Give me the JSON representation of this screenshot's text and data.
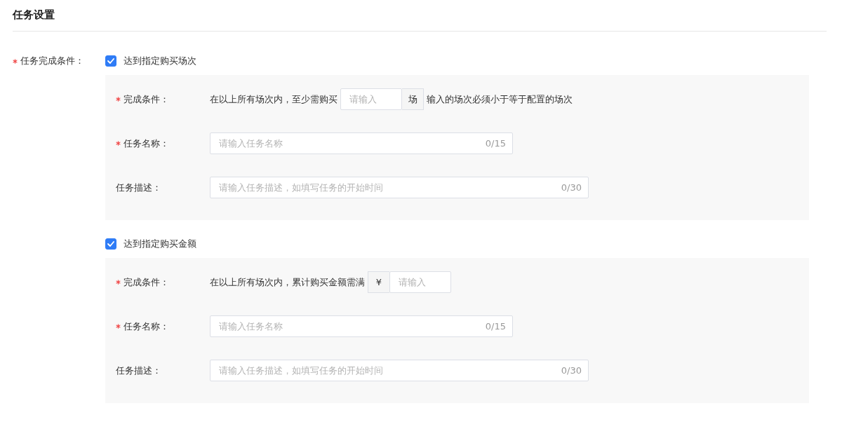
{
  "section_title": "任务设置",
  "field": {
    "label": "任务完成条件：",
    "required": true
  },
  "options": [
    {
      "label": "达到指定购买场次",
      "checked": true,
      "rows": [
        {
          "kind": "condition",
          "label": "完成条件：",
          "required": true,
          "text_before": "在以上所有场次内，至少需购买",
          "input_group": [
            {
              "kind": "input",
              "placeholder": "请输入"
            },
            {
              "kind": "addon",
              "text": "场"
            }
          ],
          "text_after": "输入的场次必须小于等于配置的场次"
        },
        {
          "kind": "name",
          "label": "任务名称：",
          "required": true,
          "placeholder": "请输入任务名称",
          "counter": "0/15"
        },
        {
          "kind": "description",
          "label": "任务描述：",
          "required": false,
          "placeholder": "请输入任务描述，如填写任务的开始时间",
          "counter": "0/30"
        }
      ]
    },
    {
      "label": "达到指定购买金额",
      "checked": true,
      "rows": [
        {
          "kind": "condition",
          "label": "完成条件：",
          "required": true,
          "text_before": "在以上所有场次内，累计购买金额需满",
          "input_group": [
            {
              "kind": "addon",
              "text": "¥"
            },
            {
              "kind": "input",
              "placeholder": "请输入"
            }
          ]
        },
        {
          "kind": "name",
          "label": "任务名称：",
          "required": true,
          "placeholder": "请输入任务名称",
          "counter": "0/15"
        },
        {
          "kind": "description",
          "label": "任务描述：",
          "required": false,
          "placeholder": "请输入任务描述，如填写任务的开始时间",
          "counter": "0/30"
        }
      ]
    }
  ]
}
